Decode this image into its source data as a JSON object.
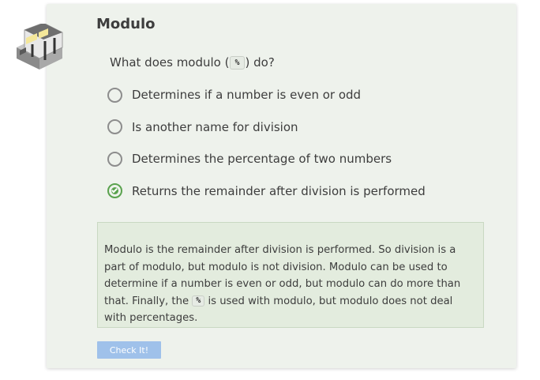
{
  "header": {
    "title": "Modulo"
  },
  "question": {
    "before_code": "What does modulo (",
    "code": "%",
    "after_code": ") do?"
  },
  "options": [
    {
      "label": "Determines if a number is even or odd",
      "selected": false
    },
    {
      "label": "Is another name for division",
      "selected": false
    },
    {
      "label": "Determines the percentage of two numbers",
      "selected": false
    },
    {
      "label": "Returns the remainder after division is performed",
      "selected": true
    }
  ],
  "feedback": {
    "text_1": "Modulo is the remainder after division is performed. So division is a part of modulo, but modulo is not division. Modulo can be used to determine if a number is even or odd, but modulo can do more than that. Finally, the ",
    "code": "%",
    "text_2": " is used with modulo, but modulo does not deal with percentages."
  },
  "check_button": {
    "label": "Check It!"
  },
  "colors": {
    "card_bg": "#eef2ec",
    "feedback_bg": "#e3ecde",
    "selected_green": "#5aa24e",
    "button_blue": "#9fc1ea"
  },
  "icons": {
    "logo": "station-building-icon"
  }
}
